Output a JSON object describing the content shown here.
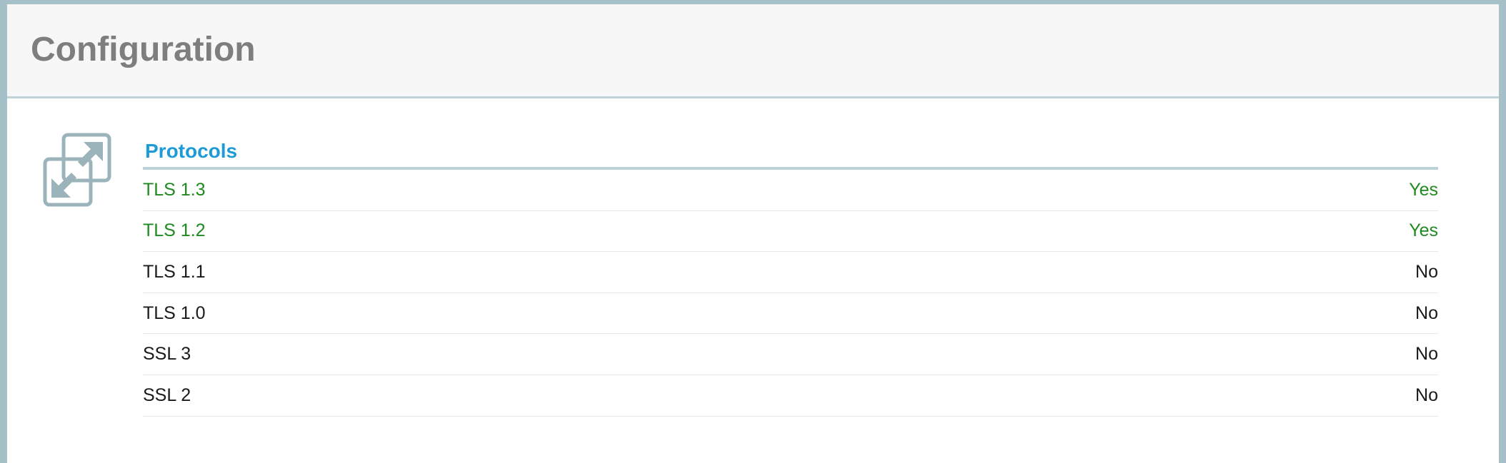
{
  "header": {
    "title": "Configuration"
  },
  "section": {
    "icon": "expand-arrows-icon",
    "title": "Protocols",
    "rows": [
      {
        "label": "TLS 1.3",
        "value": "Yes",
        "status": "on"
      },
      {
        "label": "TLS 1.2",
        "value": "Yes",
        "status": "on"
      },
      {
        "label": "TLS 1.1",
        "value": "No",
        "status": "off"
      },
      {
        "label": "TLS 1.0",
        "value": "No",
        "status": "off"
      },
      {
        "label": "SSL 3",
        "value": "No",
        "status": "off"
      },
      {
        "label": "SSL 2",
        "value": "No",
        "status": "off"
      }
    ]
  },
  "colors": {
    "frame": "#a6c0c7",
    "title": "#7e7e7e",
    "section_title": "#1e9bd7",
    "enabled": "#1f8a1f",
    "disabled": "#1a1a1a",
    "icon": "#9bb3bb"
  }
}
